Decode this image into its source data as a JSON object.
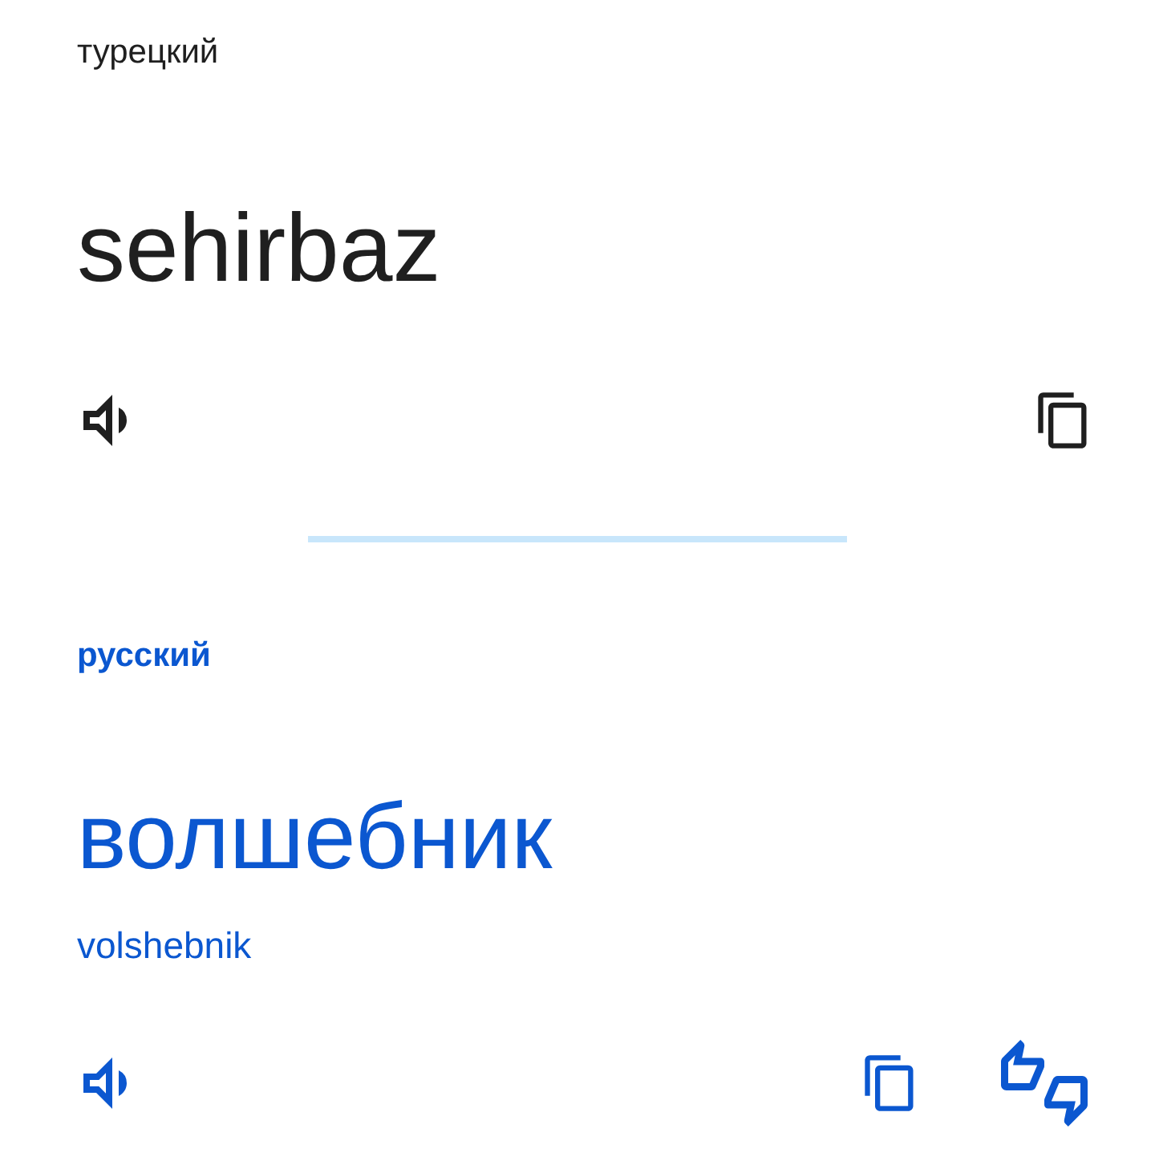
{
  "source": {
    "language": "турецкий",
    "text": "sehirbaz"
  },
  "target": {
    "language": "русский",
    "text": "волшебник",
    "transliteration": "volshebnik"
  }
}
